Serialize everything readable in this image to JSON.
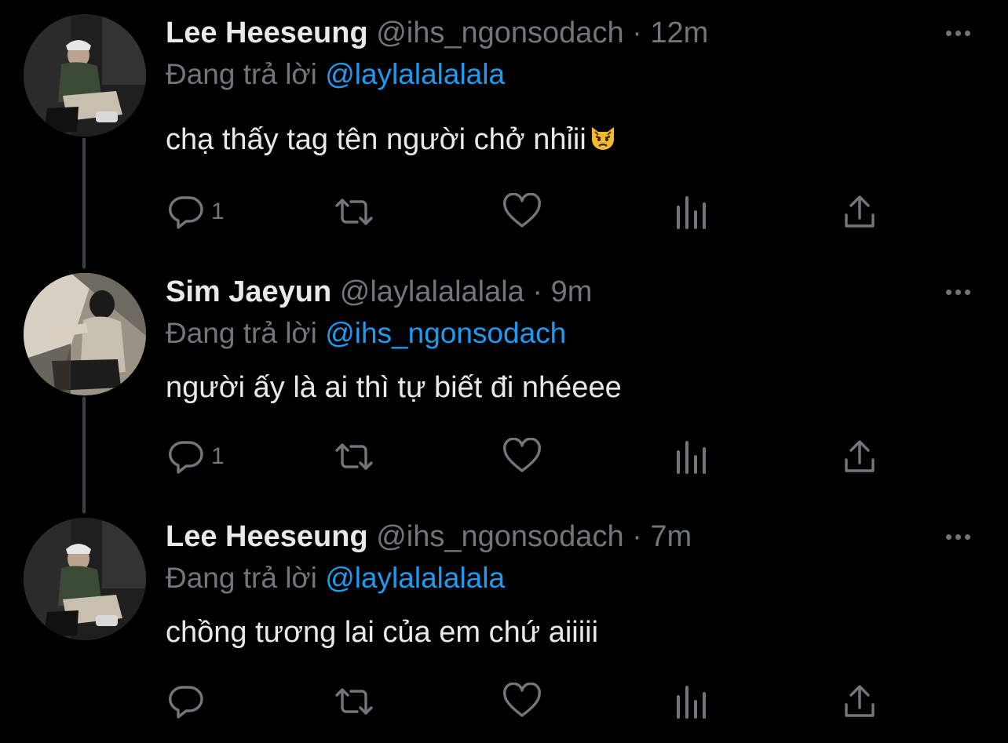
{
  "colors": {
    "background": "#000000",
    "primary_text": "#e7e9ea",
    "secondary_text": "#71767b",
    "mention": "#1d9bf0",
    "thread_line": "#3d4044"
  },
  "tweets": [
    {
      "display_name": "Lee Heeseung",
      "handle": "@ihs_ngonsodach",
      "separator": "·",
      "time": "12m",
      "reply_prefix": "Đang trả lời",
      "reply_to": "@laylalalalala",
      "text": " chạ thấy tag tên người chở nhỉii",
      "emoji": "pouting-cat",
      "reply_count": "1"
    },
    {
      "display_name": "Sim Jaeyun",
      "handle": "@laylalalalala",
      "separator": "·",
      "time": "9m",
      "reply_prefix": "Đang trả lời",
      "reply_to": "@ihs_ngonsodach",
      "text": "người ấy là ai thì tự biết đi nhéeee",
      "reply_count": "1"
    },
    {
      "display_name": "Lee Heeseung",
      "handle": "@ihs_ngonsodach",
      "separator": "·",
      "time": "7m",
      "reply_prefix": "Đang trả lời",
      "reply_to": "@laylalalalala",
      "text": "chồng tương lai của em chứ aiiiii",
      "reply_count": ""
    }
  ],
  "icons": {
    "reply": "speech-bubble-icon",
    "retweet": "retweet-icon",
    "like": "heart-icon",
    "views": "bar-chart-icon",
    "share": "share-icon",
    "more": "more-dots-icon"
  }
}
